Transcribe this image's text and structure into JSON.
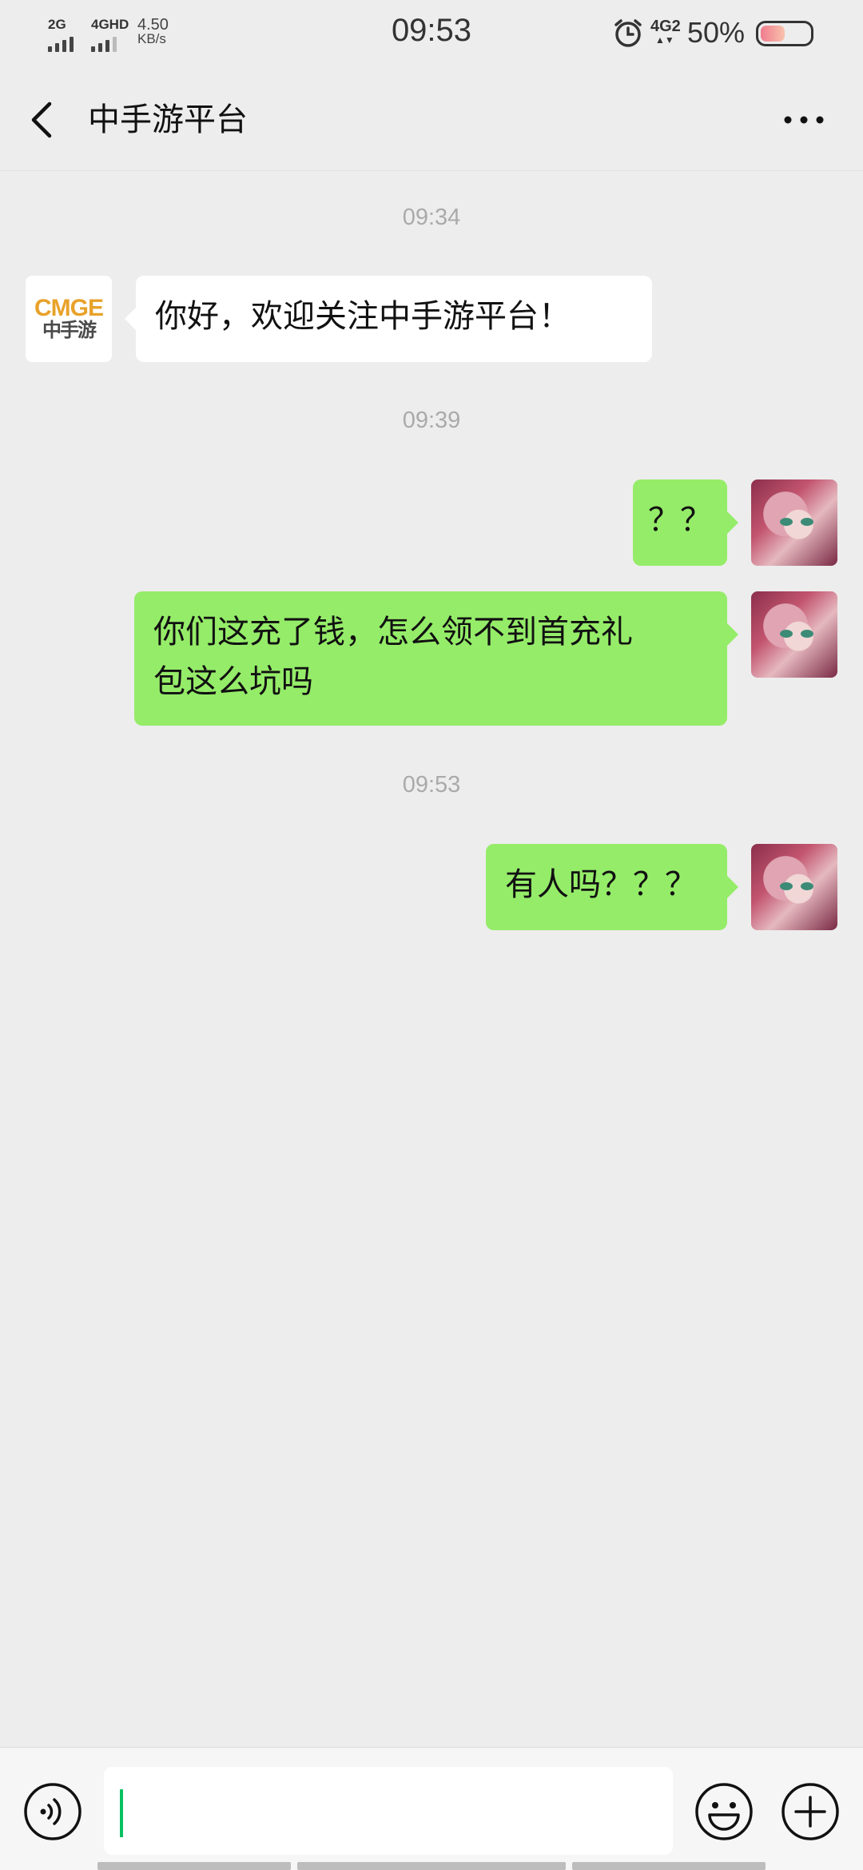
{
  "status_bar": {
    "sim1_label": "2G",
    "sim2_label": "4GHD",
    "net_speed_value": "4.50",
    "net_speed_unit": "KB/s",
    "time": "09:53",
    "network_label": "4G2",
    "battery_percent": "50%",
    "battery_level": 0.5
  },
  "header": {
    "title": "中手游平台",
    "back_icon": "chevron-left-icon",
    "more_icon": "more-dots-icon"
  },
  "messages": [
    {
      "type": "time",
      "text": "09:34"
    },
    {
      "type": "incoming",
      "sender_logo_en": "CMGE",
      "sender_logo_cn": "中手游",
      "text": "你好，欢迎关注中手游平台！"
    },
    {
      "type": "time",
      "text": "09:39"
    },
    {
      "type": "outgoing",
      "text": "？？"
    },
    {
      "type": "outgoing",
      "text_line1": "你们这充了钱，怎么领不到首充礼",
      "text_line2": "包这么坑吗"
    },
    {
      "type": "time",
      "text": "09:53"
    },
    {
      "type": "outgoing",
      "text": "有人吗？？？"
    }
  ],
  "input_bar": {
    "voice_icon": "voice-icon",
    "input_value": "",
    "emoji_icon": "emoji-icon",
    "plus_icon": "plus-icon"
  },
  "colors": {
    "background": "#ededed",
    "outgoing_bubble": "#95ec69",
    "incoming_bubble": "#ffffff",
    "cursor": "#07c160",
    "logo_orange": "#e8a22a"
  }
}
